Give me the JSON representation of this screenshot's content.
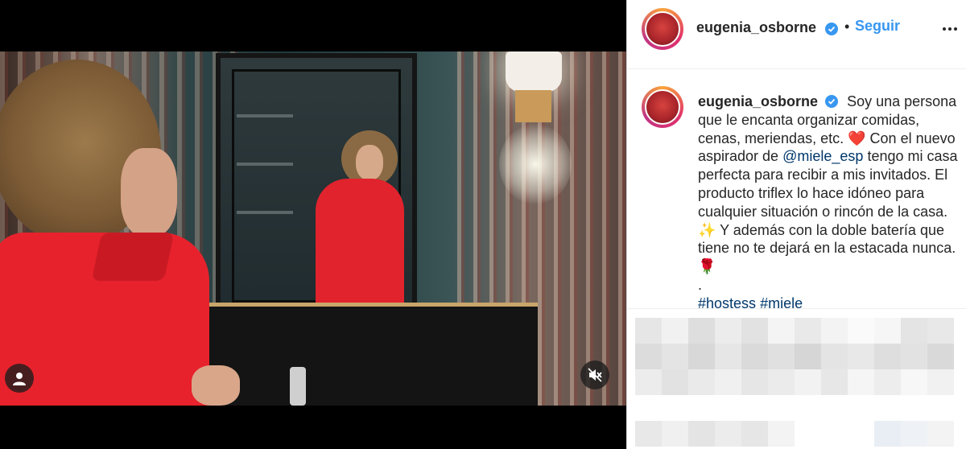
{
  "post": {
    "username": "eugenia_osborne",
    "follow_label": "Seguir",
    "separator": "•",
    "caption": {
      "username": "eugenia_osborne",
      "text_1": "Soy una persona que le encanta organizar comidas, cenas, meriendas, etc.",
      "heart": "❤️",
      "text_2": "Con el nuevo aspirador de",
      "mention": "@miele_esp",
      "text_3": "tengo mi casa perfecta para recibir a mis invitados. El producto triflex lo hace idóneo para cualquier situación o rincón de la casa.",
      "sparkles": "✨",
      "text_4": "Y además con la doble batería que tiene no te dejará en la estacada nunca.",
      "rose": "🌹",
      "dot_line": ".",
      "hashtag_1": "#hostess",
      "hashtag_2": "#miele"
    }
  },
  "icons": {
    "verified": "verified-badge-icon",
    "more": "more-options-icon",
    "user_tag": "user-tag-icon",
    "mute": "mute-icon"
  },
  "colors": {
    "link_blue": "#3897f0",
    "text_dark": "#262626",
    "hashtag_blue": "#00376b"
  }
}
